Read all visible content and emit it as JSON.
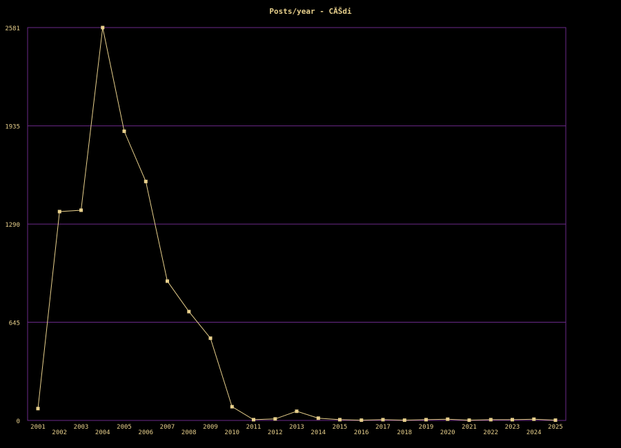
{
  "chart_data": {
    "type": "line",
    "title": "Posts/year - CĂŠdi",
    "xlabel": "",
    "ylabel": "",
    "categories": [
      "2001",
      "2002",
      "2003",
      "2004",
      "2005",
      "2006",
      "2007",
      "2008",
      "2009",
      "2010",
      "2011",
      "2012",
      "2013",
      "2014",
      "2015",
      "2016",
      "2017",
      "2018",
      "2019",
      "2020",
      "2021",
      "2022",
      "2023",
      "2024",
      "2025"
    ],
    "values": [
      78,
      1372,
      1381,
      2581,
      1900,
      1570,
      915,
      715,
      540,
      90,
      5,
      10,
      60,
      15,
      5,
      2,
      5,
      2,
      5,
      8,
      2,
      5,
      5,
      8,
      2
    ],
    "y_ticks": [
      "0",
      "645",
      "1290",
      "1935",
      "2581"
    ],
    "y_tick_values": [
      0,
      645,
      1290,
      1935,
      2581
    ],
    "ylim": [
      0,
      2581
    ],
    "grid": "horizontal",
    "colors": {
      "background": "#000000",
      "frame": "#6b2a8a",
      "grid": "#6b2a8a",
      "series": "#e8d08c",
      "text": "#e8d08c"
    }
  }
}
